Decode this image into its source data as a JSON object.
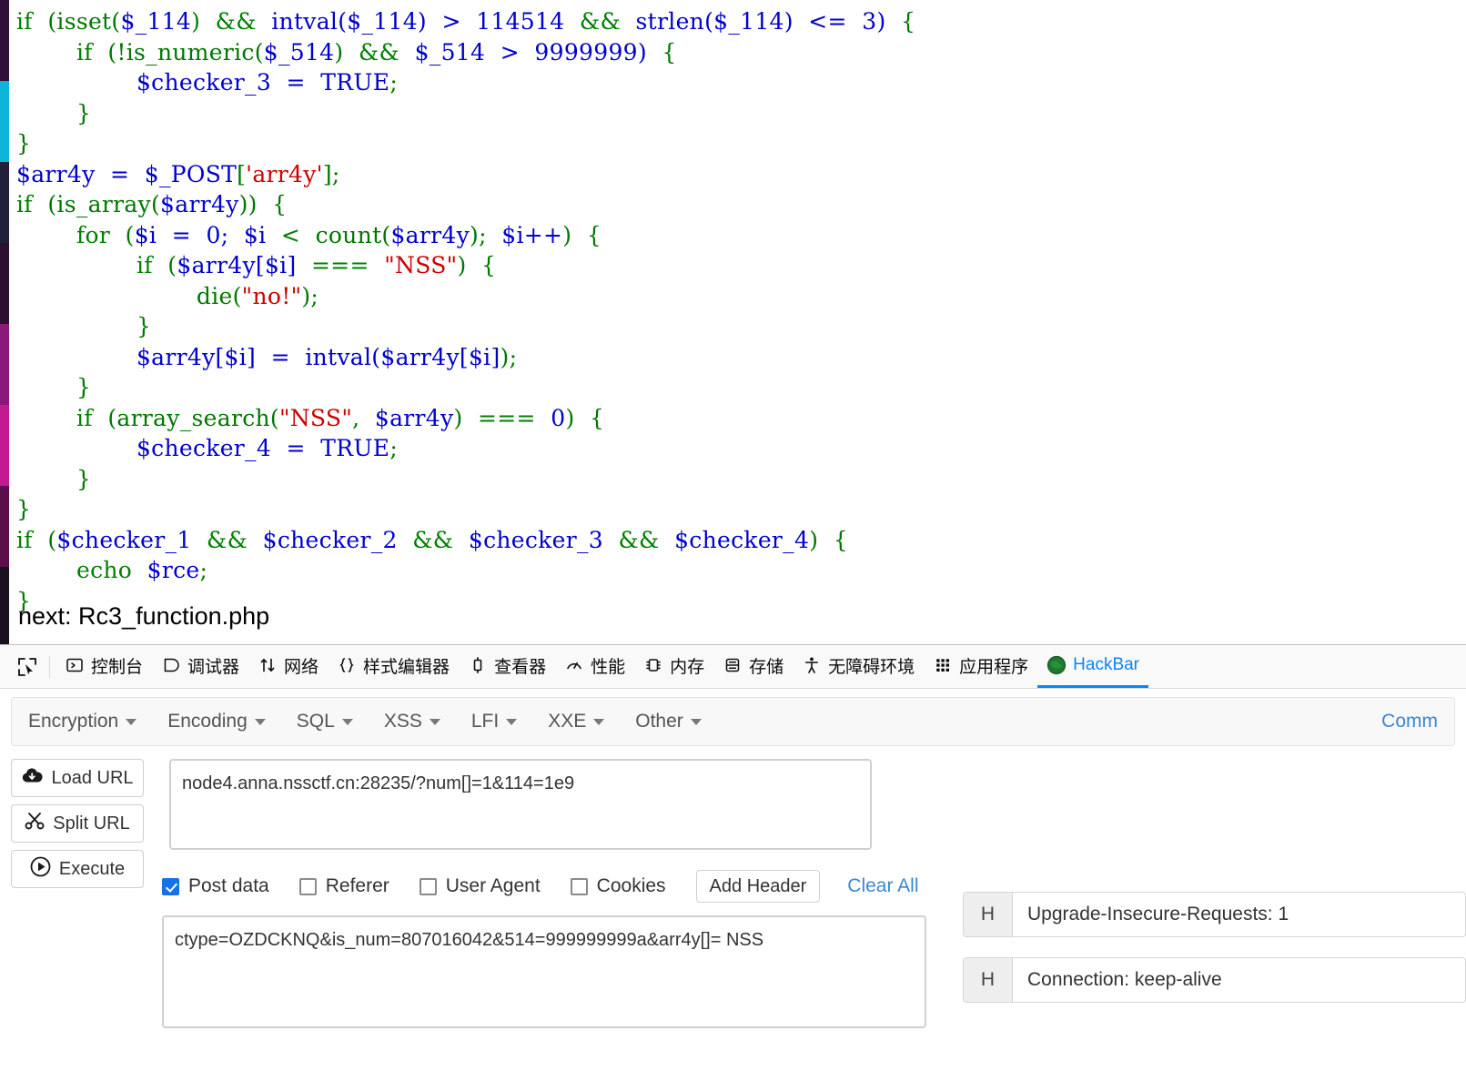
{
  "page": {
    "code_lines": [
      [
        {
          "t": "if",
          "c": "k"
        },
        {
          "t": "  (isset(",
          "c": "p"
        },
        {
          "t": "$_114",
          "c": "v"
        },
        {
          "t": ")  &&  ",
          "c": "k"
        },
        {
          "t": "intval(",
          "c": "v"
        },
        {
          "t": "$_114",
          "c": "v"
        },
        {
          "t": ")  >  114514",
          "c": "v"
        },
        {
          "t": "  &&  ",
          "c": "k"
        },
        {
          "t": "strlen(",
          "c": "v"
        },
        {
          "t": "$_114",
          "c": "v"
        },
        {
          "t": ")  <=  3)",
          "c": "v"
        },
        {
          "t": "  {",
          "c": "p"
        }
      ],
      [
        {
          "t": "        if",
          "c": "k"
        },
        {
          "t": "  (!is_numeric(",
          "c": "p"
        },
        {
          "t": "$_514",
          "c": "v"
        },
        {
          "t": ")",
          "c": "p"
        },
        {
          "t": "  &&  ",
          "c": "k"
        },
        {
          "t": "$_514",
          "c": "v"
        },
        {
          "t": "  >  9999999)",
          "c": "v"
        },
        {
          "t": "  {",
          "c": "p"
        }
      ],
      [
        {
          "t": "                ",
          "c": "p"
        },
        {
          "t": "$checker_3  =  TRUE",
          "c": "v"
        },
        {
          "t": ";",
          "c": "p"
        }
      ],
      [
        {
          "t": "        }",
          "c": "p"
        }
      ],
      [
        {
          "t": "}",
          "c": "p"
        }
      ],
      [
        {
          "t": "$arr4y  =  $_POST",
          "c": "v"
        },
        {
          "t": "[",
          "c": "p"
        },
        {
          "t": "'arr4y'",
          "c": "s"
        },
        {
          "t": "];",
          "c": "p"
        }
      ],
      [
        {
          "t": "if",
          "c": "k"
        },
        {
          "t": "  (is_array(",
          "c": "p"
        },
        {
          "t": "$arr4y",
          "c": "v"
        },
        {
          "t": "))  {",
          "c": "p"
        }
      ],
      [
        {
          "t": "        for",
          "c": "k"
        },
        {
          "t": "  (",
          "c": "p"
        },
        {
          "t": "$i  =  0;  $i",
          "c": "v"
        },
        {
          "t": "  <  ",
          "c": "k"
        },
        {
          "t": "count(",
          "c": "p"
        },
        {
          "t": "$arr4y",
          "c": "v"
        },
        {
          "t": ");  ",
          "c": "p"
        },
        {
          "t": "$i++",
          "c": "v"
        },
        {
          "t": ")  {",
          "c": "p"
        }
      ],
      [
        {
          "t": "                if",
          "c": "k"
        },
        {
          "t": "  (",
          "c": "p"
        },
        {
          "t": "$arr4y[$i]",
          "c": "v"
        },
        {
          "t": "  ===  ",
          "c": "k"
        },
        {
          "t": "\"NSS\"",
          "c": "s"
        },
        {
          "t": ")  {",
          "c": "p"
        }
      ],
      [
        {
          "t": "                        die(",
          "c": "p"
        },
        {
          "t": "\"no!\"",
          "c": "s"
        },
        {
          "t": ");",
          "c": "p"
        }
      ],
      [
        {
          "t": "                }",
          "c": "p"
        }
      ],
      [
        {
          "t": "                ",
          "c": "p"
        },
        {
          "t": "$arr4y[$i]  =  ",
          "c": "v"
        },
        {
          "t": "intval(",
          "c": "v"
        },
        {
          "t": "$arr4y[$i]",
          "c": "v"
        },
        {
          "t": ");",
          "c": "p"
        }
      ],
      [
        {
          "t": "        }",
          "c": "p"
        }
      ],
      [
        {
          "t": "        if",
          "c": "k"
        },
        {
          "t": "  (array_search(",
          "c": "p"
        },
        {
          "t": "\"NSS\"",
          "c": "s"
        },
        {
          "t": ",  ",
          "c": "p"
        },
        {
          "t": "$arr4y",
          "c": "v"
        },
        {
          "t": ")  ",
          "c": "p"
        },
        {
          "t": "===  ",
          "c": "k"
        },
        {
          "t": "0",
          "c": "v"
        },
        {
          "t": ")  {",
          "c": "p"
        }
      ],
      [
        {
          "t": "                ",
          "c": "p"
        },
        {
          "t": "$checker_4  =  TRUE",
          "c": "v"
        },
        {
          "t": ";",
          "c": "p"
        }
      ],
      [
        {
          "t": "        }",
          "c": "p"
        }
      ],
      [
        {
          "t": "}",
          "c": "p"
        }
      ],
      [
        {
          "t": "if",
          "c": "k"
        },
        {
          "t": "  (",
          "c": "p"
        },
        {
          "t": "$checker_1",
          "c": "v"
        },
        {
          "t": "  &&  ",
          "c": "k"
        },
        {
          "t": "$checker_2",
          "c": "v"
        },
        {
          "t": "  &&  ",
          "c": "k"
        },
        {
          "t": "$checker_3",
          "c": "v"
        },
        {
          "t": "  &&  ",
          "c": "k"
        },
        {
          "t": "$checker_4",
          "c": "v"
        },
        {
          "t": ")  {",
          "c": "p"
        }
      ],
      [
        {
          "t": "        echo",
          "c": "k"
        },
        {
          "t": "  ",
          "c": "p"
        },
        {
          "t": "$rce",
          "c": "v"
        },
        {
          "t": ";",
          "c": "p"
        }
      ],
      [
        {
          "t": "}",
          "c": "p"
        }
      ]
    ],
    "next_text": "next: Rc3_function.php",
    "left_strip_colors": [
      "#2e1038",
      "#0fb5d8",
      "#20203a",
      "#2b1033",
      "#8a1a7a",
      "#c41a8f",
      "#5a0f4a",
      "#1a1020"
    ]
  },
  "devtools": {
    "picker_icon": "element-picker-icon",
    "tabs": [
      {
        "label": "控制台",
        "icon": "console-icon",
        "active": false
      },
      {
        "label": "调试器",
        "icon": "debugger-icon",
        "active": false
      },
      {
        "label": "网络",
        "icon": "network-icon",
        "active": false
      },
      {
        "label": "样式编辑器",
        "icon": "style-editor-icon",
        "active": false
      },
      {
        "label": "查看器",
        "icon": "inspector-icon",
        "active": false
      },
      {
        "label": "性能",
        "icon": "performance-icon",
        "active": false
      },
      {
        "label": "内存",
        "icon": "memory-icon",
        "active": false
      },
      {
        "label": "存储",
        "icon": "storage-icon",
        "active": false
      },
      {
        "label": "无障碍环境",
        "icon": "accessibility-icon",
        "active": false
      },
      {
        "label": "应用程序",
        "icon": "application-icon",
        "active": false
      },
      {
        "label": "HackBar",
        "icon": "hackbar-icon",
        "active": true
      }
    ],
    "active_color": "#0a84ff"
  },
  "hackbar": {
    "menu": [
      {
        "label": "Encryption"
      },
      {
        "label": "Encoding"
      },
      {
        "label": "SQL"
      },
      {
        "label": "XSS"
      },
      {
        "label": "LFI"
      },
      {
        "label": "XXE"
      },
      {
        "label": "Other"
      }
    ],
    "menu_right_label": "Comm",
    "buttons": {
      "load_url": "Load URL",
      "split_url": "Split URL",
      "execute": "Execute"
    },
    "url_value": "node4.anna.nssctf.cn:28235/?num[]=1&114=1e9",
    "url_placeholder": "",
    "checkboxes": [
      {
        "label": "Post data",
        "checked": true
      },
      {
        "label": "Referer",
        "checked": false
      },
      {
        "label": "User Agent",
        "checked": false
      },
      {
        "label": "Cookies",
        "checked": false
      }
    ],
    "add_header_label": "Add Header",
    "clear_all_label": "Clear All",
    "post_data_value": "ctype=OZDCKNQ&is_num=807016042&514=999999999a&arr4y[]= NSS",
    "post_data_placeholder": "",
    "headers": [
      {
        "tag": "H",
        "value": "Upgrade-Insecure-Requests: 1"
      },
      {
        "tag": "H",
        "value": "Connection: keep-alive"
      }
    ],
    "accent_link_color": "#3a87d4",
    "checkbox_checked_color": "#1673e6"
  }
}
